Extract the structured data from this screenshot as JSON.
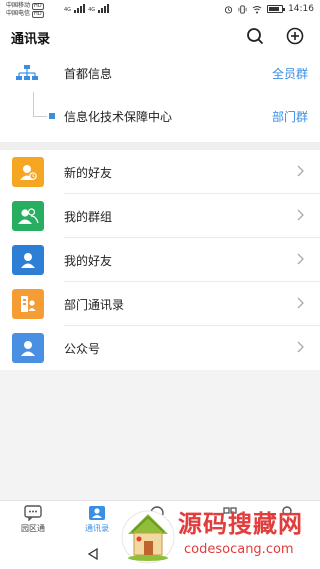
{
  "status_bar": {
    "carrier1": "中国移动",
    "carrier2": "中国电信",
    "hd": "HD",
    "net1": "4G",
    "net2": "4G",
    "time": "14:16",
    "battery_level": 0.8
  },
  "header": {
    "title": "通讯录",
    "search_icon": "search-icon",
    "add_icon": "add-circle-icon"
  },
  "org": {
    "top": {
      "name": "首都信息",
      "tag": "全员群"
    },
    "sub": {
      "name": "信息化技术保障中心",
      "tag": "部门群"
    }
  },
  "list": [
    {
      "label": "新的好友",
      "icon": "new-friend-icon",
      "color": "#f5a623"
    },
    {
      "label": "我的群组",
      "icon": "group-icon",
      "color": "#27ae60"
    },
    {
      "label": "我的好友",
      "icon": "friend-icon",
      "color": "#2d7fd6"
    },
    {
      "label": "部门通讯录",
      "icon": "department-icon",
      "color": "#f59c34"
    },
    {
      "label": "公众号",
      "icon": "public-account-icon",
      "color": "#4a90e2"
    }
  ],
  "bottom_nav": {
    "item1": "园区通",
    "item2": "通讯录"
  },
  "watermark": {
    "title": "源码搜藏网",
    "site": "codesocang.com"
  },
  "colors": {
    "accent": "#3a8ee6"
  }
}
